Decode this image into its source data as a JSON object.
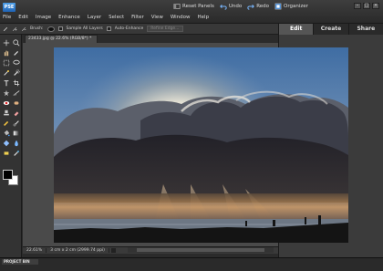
{
  "app": {
    "logo": "PSE"
  },
  "menu": [
    "File",
    "Edit",
    "Image",
    "Enhance",
    "Layer",
    "Select",
    "Filter",
    "View",
    "Window",
    "Help"
  ],
  "toolbar": {
    "reset_panels": "Reset Panels",
    "undo": "Undo",
    "redo": "Redo",
    "organizer": "Organizer"
  },
  "options": {
    "brush_label": "Brush:",
    "sample_all_layers": "Sample All Layers",
    "auto_enhance": "Auto-Enhance",
    "refine_edge": "Refine Edge..."
  },
  "tabs": [
    {
      "label": "Edit",
      "active": true
    },
    {
      "label": "Create",
      "active": false
    },
    {
      "label": "Share",
      "active": false
    }
  ],
  "document": {
    "tab_title": "23433.jpg @ 22.6% (RGB/8*) *"
  },
  "status": {
    "zoom": "22.61%",
    "info": "3 cm x 2 cm (2999.74 ppi)"
  },
  "project_bin": {
    "label": "PROJECT BIN"
  },
  "colors": {
    "accent": "#1f62b4",
    "panel": "#3b3b3b",
    "active_tab": "#555555"
  }
}
